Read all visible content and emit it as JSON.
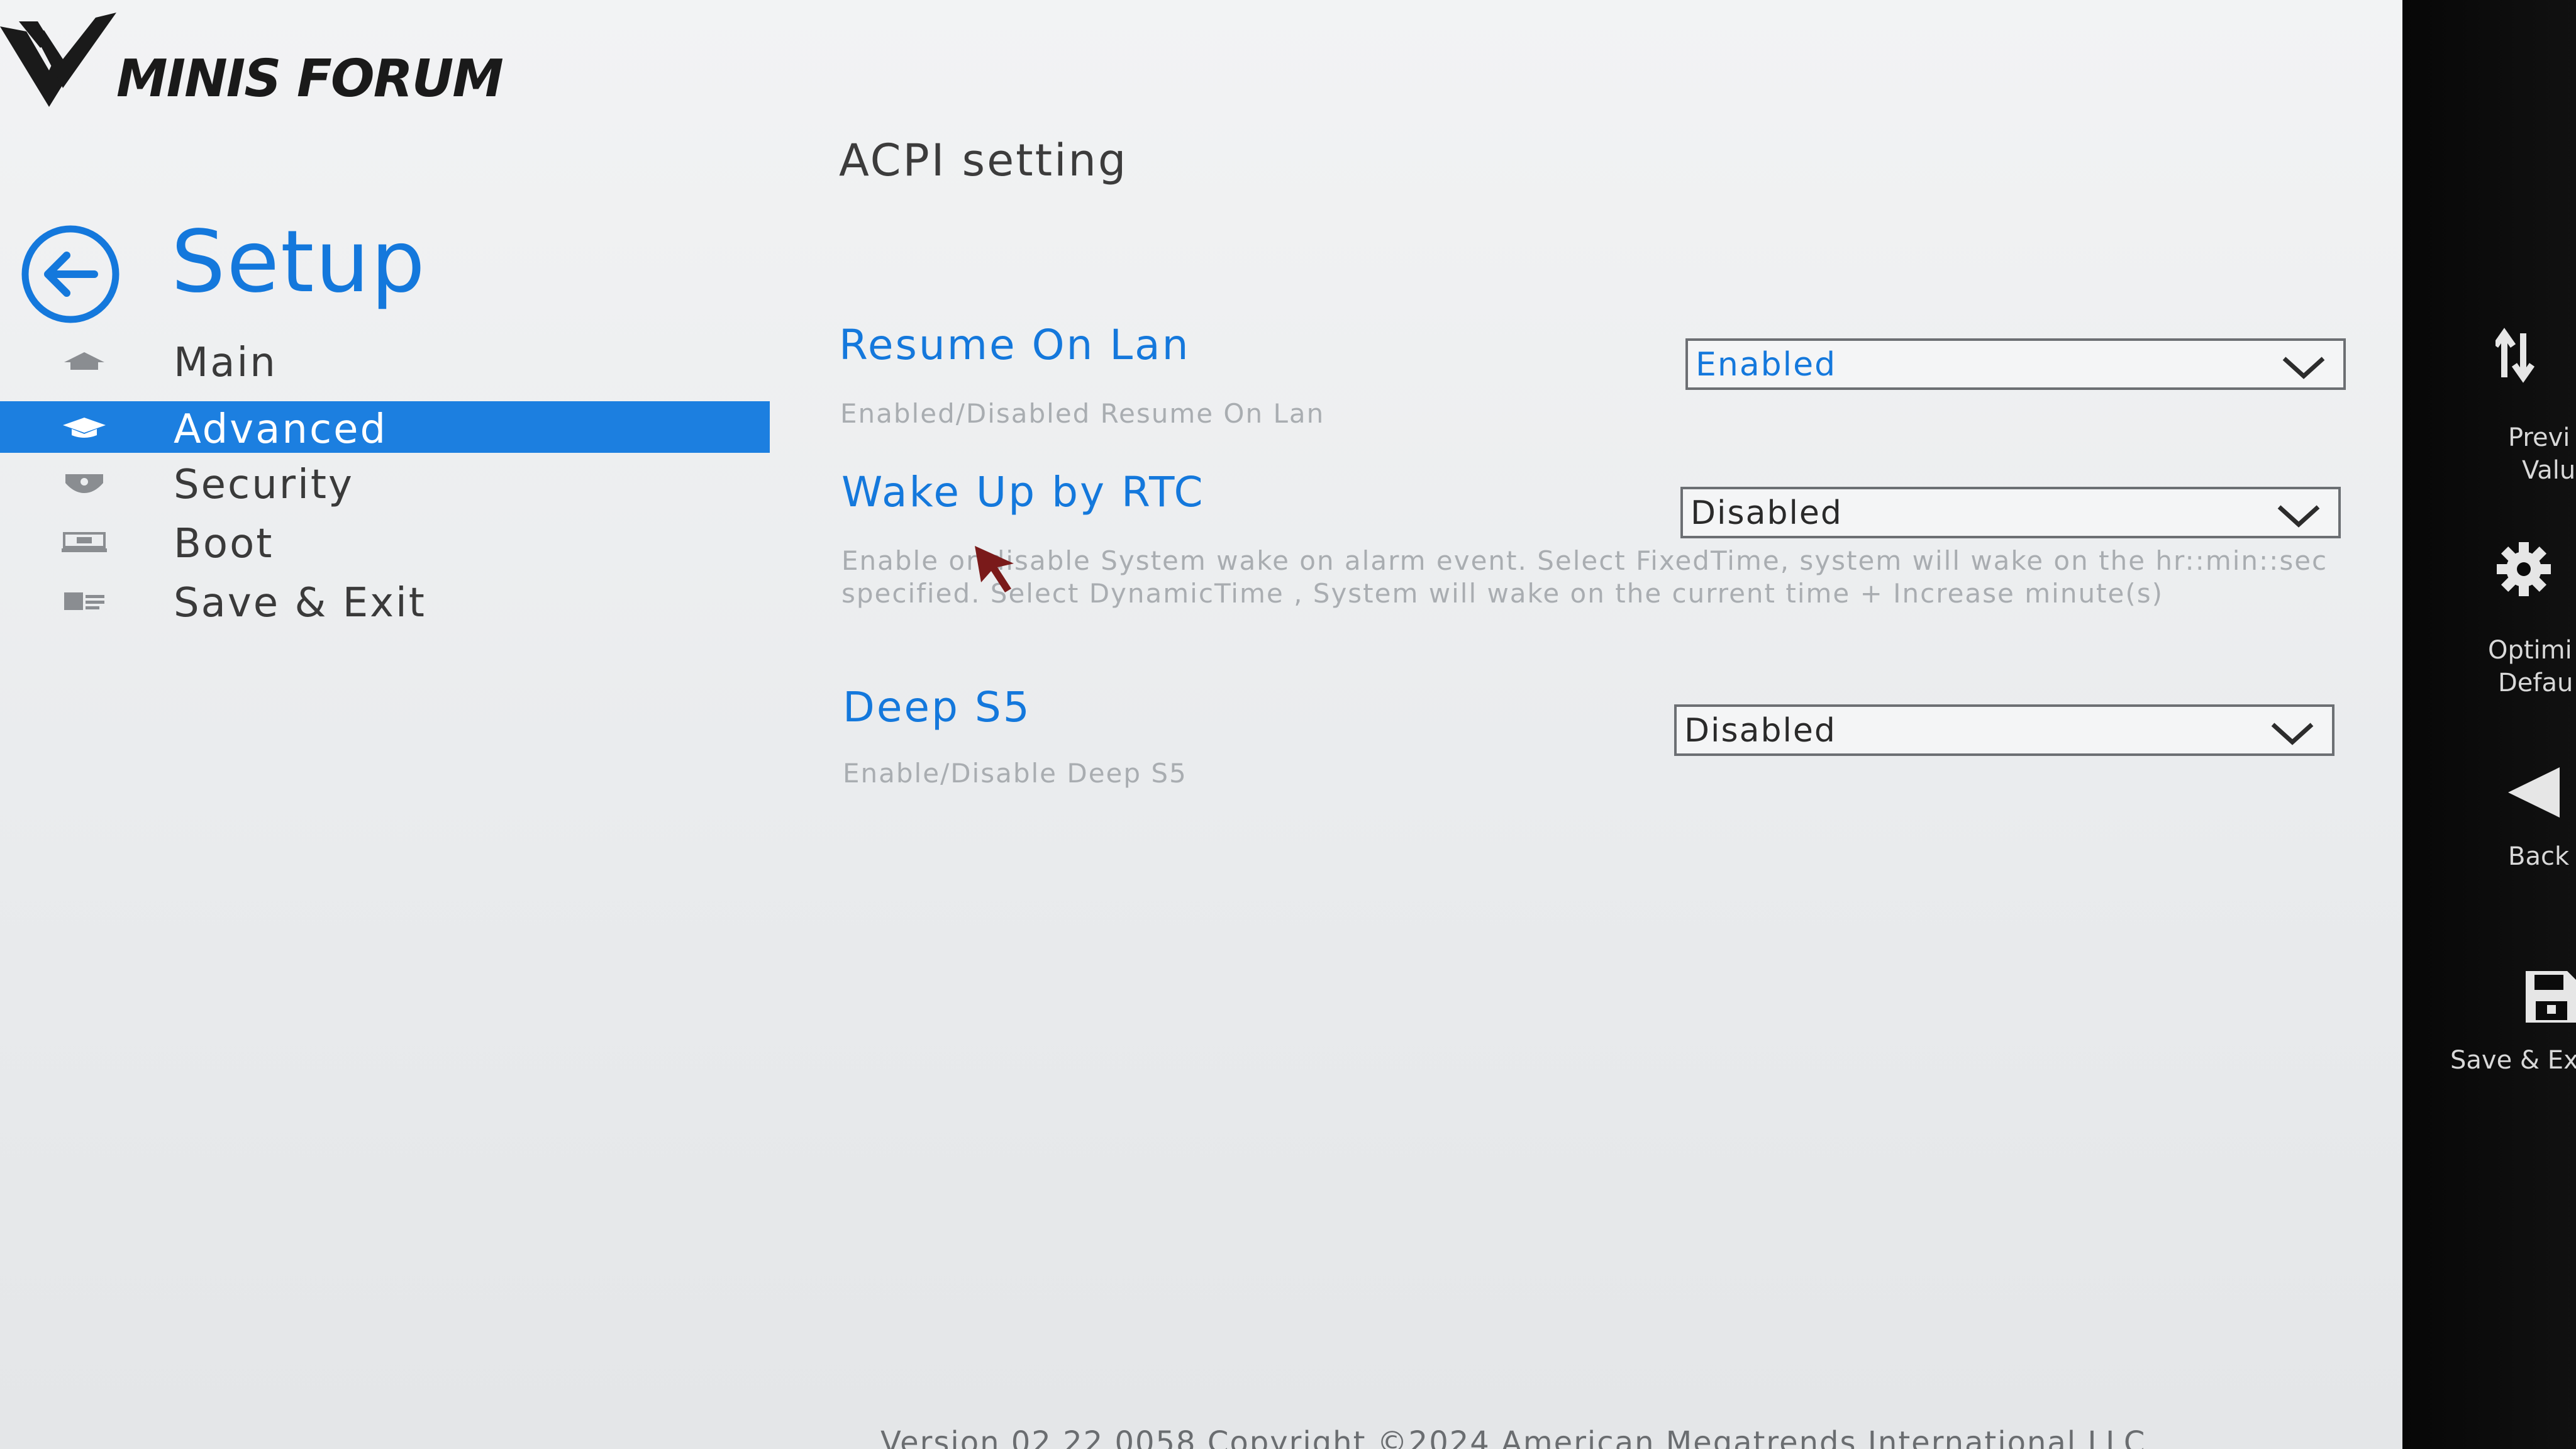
{
  "brand": {
    "logo_text": "MINIS FORUM"
  },
  "header": {
    "title": "Setup"
  },
  "sidebar": {
    "items": [
      {
        "label": "Main",
        "icon": "home-icon",
        "active": false
      },
      {
        "label": "Advanced",
        "icon": "advanced-icon",
        "active": true
      },
      {
        "label": "Security",
        "icon": "shield-icon",
        "active": false
      },
      {
        "label": "Boot",
        "icon": "boot-icon",
        "active": false
      },
      {
        "label": "Save & Exit",
        "icon": "save-exit-icon",
        "active": false
      }
    ]
  },
  "page": {
    "title": "ACPI setting",
    "settings": [
      {
        "name": "Resume On Lan",
        "description": "Enabled/Disabled Resume On Lan",
        "value": "Enabled"
      },
      {
        "name": "Wake Up by RTC",
        "description": "Enable or disable System wake on alarm event. Select FixedTime, system will wake on the hr::min::sec specified. Select DynamicTime , System will wake on the current time + Increase minute(s)",
        "value": "Disabled"
      },
      {
        "name": "Deep S5",
        "description": "Enable/Disable Deep S5",
        "value": "Disabled"
      }
    ]
  },
  "toolbar": {
    "items": [
      {
        "label_line1": "Previ",
        "label_line2": "Valu",
        "icon": "previous-values-icon"
      },
      {
        "label_line1": "Optimi",
        "label_line2": "Defau",
        "icon": "gear-icon"
      },
      {
        "label_line1": "Back",
        "label_line2": "",
        "icon": "back-triangle-icon"
      },
      {
        "label_line1": "Save & Ex",
        "label_line2": "",
        "icon": "floppy-disk-icon"
      }
    ]
  },
  "footer": {
    "text": "Version 02.22.0058 Copyright ©2024 American Megatrends International LLC"
  },
  "colors": {
    "accent": "#1478dc",
    "active_bg": "#1c7fe0",
    "toolbar_bg": "#0b0b0b"
  }
}
